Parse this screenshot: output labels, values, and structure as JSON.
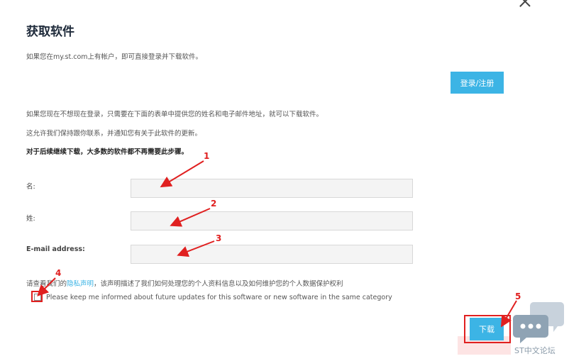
{
  "dialog": {
    "title": "获取软件",
    "intro": "如果您在my.st.com上有帐户，即可直接登录并下载软件。",
    "login_label": "登录/注册",
    "info_1": "如果您现在不想现在登录，只需要在下面的表单中提供您的姓名和电子邮件地址，就可以下载软件。",
    "info_2": "这允许我们保持跟你联系，并通知您有关于此软件的更新。",
    "info_3": "对于后续继续下载，大多数的软件都不再需要此步骤。"
  },
  "form": {
    "first_name_label": "名:",
    "last_name_label": "姓:",
    "email_label": "E-mail address:",
    "privacy_prefix": "请查看我们的",
    "privacy_link": "隐私声明",
    "privacy_suffix": "，该声明描述了我们如何处理您的个人资料信息以及如何维护您的个人数据保护权利",
    "updates_checkbox_label": "Please keep me informed about future updates for this software or new software in the same category",
    "updates_checked": false,
    "download_label": "下载"
  },
  "annotations": [
    "1",
    "2",
    "3",
    "4",
    "5"
  ],
  "watermark": {
    "text": "ST中文论坛",
    "icon": "chat-bubbles-icon"
  },
  "colors": {
    "accent": "#3cb4e5",
    "annotation": "#e02020"
  }
}
